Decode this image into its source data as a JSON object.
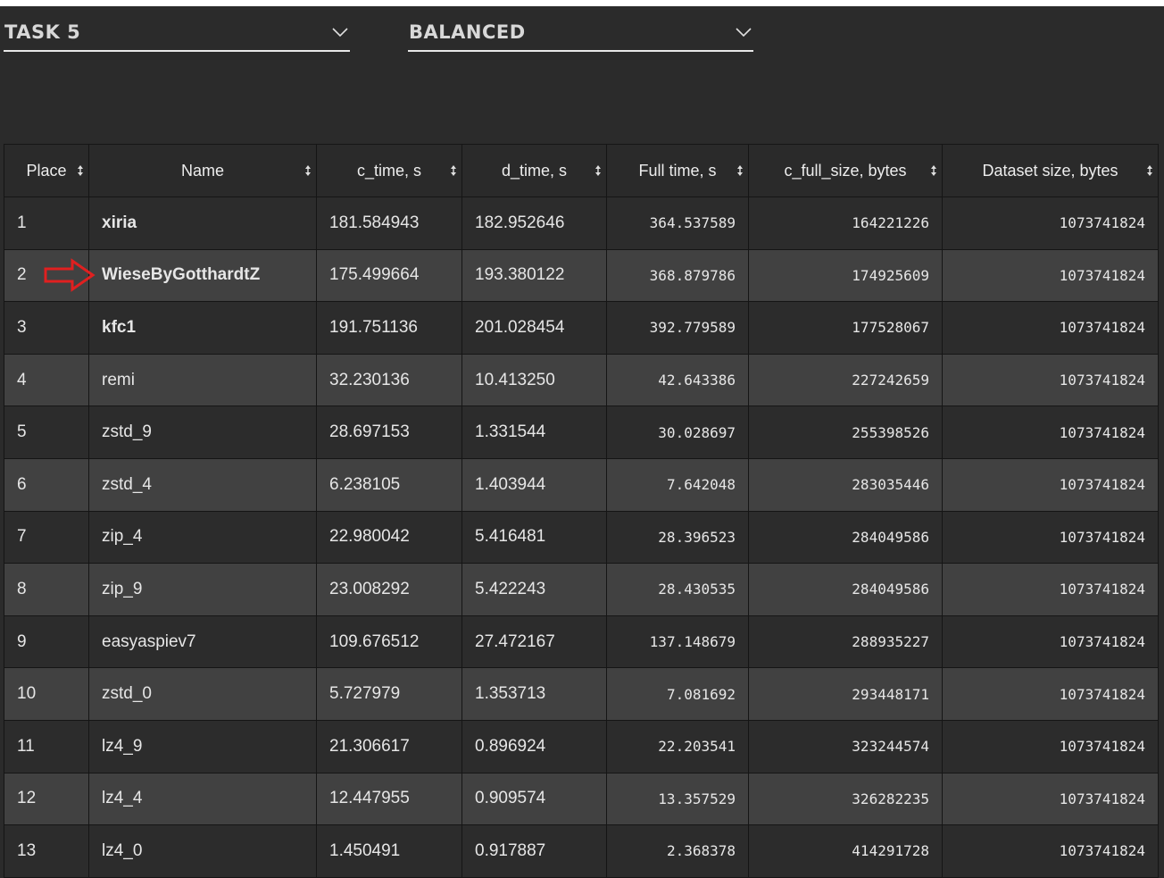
{
  "filters": {
    "task_label": "TASK 5",
    "mode_label": "BALANCED"
  },
  "table": {
    "columns": [
      "Place",
      "Name",
      "c_time, s",
      "d_time, s",
      "Full time, s",
      "c_full_size, bytes",
      "Dataset size, bytes"
    ],
    "rows": [
      {
        "place": "1",
        "name": "xiria",
        "bold": true,
        "c_time": "181.584943",
        "d_time": "182.952646",
        "full_time": "364.537589",
        "c_full_size": "164221226",
        "dataset_size": "1073741824"
      },
      {
        "place": "2",
        "name": "WieseByGotthardtZ",
        "bold": true,
        "c_time": "175.499664",
        "d_time": "193.380122",
        "full_time": "368.879786",
        "c_full_size": "174925609",
        "dataset_size": "1073741824"
      },
      {
        "place": "3",
        "name": "kfc1",
        "bold": true,
        "c_time": "191.751136",
        "d_time": "201.028454",
        "full_time": "392.779589",
        "c_full_size": "177528067",
        "dataset_size": "1073741824"
      },
      {
        "place": "4",
        "name": "remi",
        "bold": false,
        "c_time": "32.230136",
        "d_time": "10.413250",
        "full_time": "42.643386",
        "c_full_size": "227242659",
        "dataset_size": "1073741824"
      },
      {
        "place": "5",
        "name": "zstd_9",
        "bold": false,
        "c_time": "28.697153",
        "d_time": "1.331544",
        "full_time": "30.028697",
        "c_full_size": "255398526",
        "dataset_size": "1073741824"
      },
      {
        "place": "6",
        "name": "zstd_4",
        "bold": false,
        "c_time": "6.238105",
        "d_time": "1.403944",
        "full_time": "7.642048",
        "c_full_size": "283035446",
        "dataset_size": "1073741824"
      },
      {
        "place": "7",
        "name": "zip_4",
        "bold": false,
        "c_time": "22.980042",
        "d_time": "5.416481",
        "full_time": "28.396523",
        "c_full_size": "284049586",
        "dataset_size": "1073741824"
      },
      {
        "place": "8",
        "name": "zip_9",
        "bold": false,
        "c_time": "23.008292",
        "d_time": "5.422243",
        "full_time": "28.430535",
        "c_full_size": "284049586",
        "dataset_size": "1073741824"
      },
      {
        "place": "9",
        "name": "easyaspiev7",
        "bold": false,
        "c_time": "109.676512",
        "d_time": "27.472167",
        "full_time": "137.148679",
        "c_full_size": "288935227",
        "dataset_size": "1073741824"
      },
      {
        "place": "10",
        "name": "zstd_0",
        "bold": false,
        "c_time": "5.727979",
        "d_time": "1.353713",
        "full_time": "7.081692",
        "c_full_size": "293448171",
        "dataset_size": "1073741824"
      },
      {
        "place": "11",
        "name": "lz4_9",
        "bold": false,
        "c_time": "21.306617",
        "d_time": "0.896924",
        "full_time": "22.203541",
        "c_full_size": "323244574",
        "dataset_size": "1073741824"
      },
      {
        "place": "12",
        "name": "lz4_4",
        "bold": false,
        "c_time": "12.447955",
        "d_time": "0.909574",
        "full_time": "13.357529",
        "c_full_size": "326282235",
        "dataset_size": "1073741824"
      },
      {
        "place": "13",
        "name": "lz4_0",
        "bold": false,
        "c_time": "1.450491",
        "d_time": "0.917887",
        "full_time": "2.368378",
        "c_full_size": "414291728",
        "dataset_size": "1073741824"
      }
    ]
  },
  "annotation": {
    "icon": "right-arrow-icon",
    "color": "#e02020"
  }
}
